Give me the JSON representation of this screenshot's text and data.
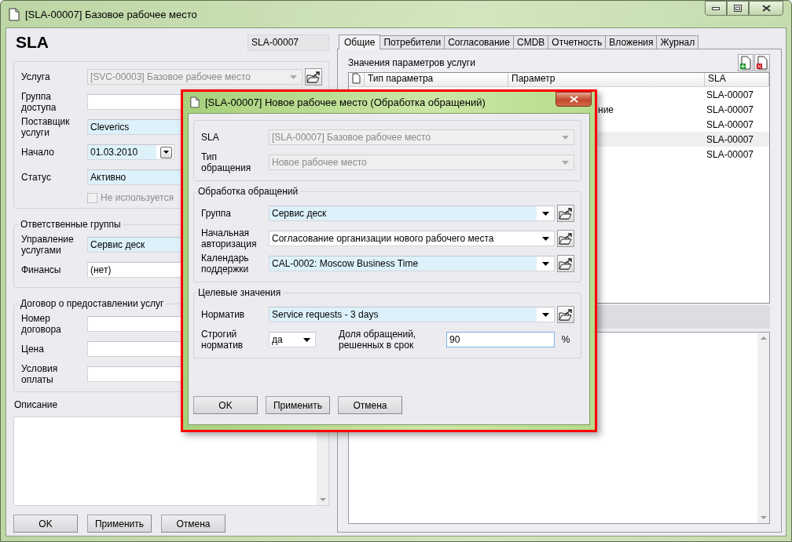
{
  "window": {
    "title": "[SLA-00007] Базовое рабочее место"
  },
  "header": {
    "title": "SLA",
    "number": "SLA-00007"
  },
  "general": {
    "fields": [
      {
        "label": "Услуга",
        "kind": "combo",
        "value": "[SVC-00003] Базовое рабочее место",
        "disabled": true,
        "link": true
      },
      {
        "label": "Группа доступа",
        "kind": "text"
      },
      {
        "label": "Поставщик услуги",
        "kind": "text",
        "value": "Cleverics",
        "required": true
      },
      {
        "label": "Начало",
        "kind": "date",
        "value": "01.03.2010",
        "required": true
      },
      {
        "label": "Статус",
        "kind": "text",
        "value": "Активно",
        "required": true
      }
    ],
    "checkbox": {
      "label": "Не используется",
      "checked": false,
      "disabled": true
    }
  },
  "responsible_groups": {
    "legend": "Ответственные группы",
    "fields": [
      {
        "label": "Управление услугами",
        "kind": "text",
        "value": "Сервис деск",
        "required": true
      },
      {
        "label": "Финансы",
        "kind": "text",
        "value": "(нет)",
        "required": false
      }
    ]
  },
  "contract": {
    "legend": "Договор о предоставлении услуг",
    "fields": [
      {
        "label": "Номер договора",
        "kind": "text"
      },
      {
        "label": "Цена",
        "kind": "text"
      },
      {
        "label": "Условия оплаты",
        "kind": "text"
      }
    ]
  },
  "description": {
    "label": "Описание"
  },
  "buttons": [
    "OK",
    "Применить",
    "Отмена"
  ],
  "tabs": [
    {
      "label": "Общие",
      "selected": true
    },
    {
      "label": "Потребители",
      "selected": false
    },
    {
      "label": "Согласование",
      "selected": false
    },
    {
      "label": "CMDB",
      "selected": false
    },
    {
      "label": "Отчетность",
      "selected": false
    },
    {
      "label": "Вложения",
      "selected": false
    },
    {
      "label": "Журнал",
      "selected": false
    }
  ],
  "parameters": {
    "title": "Значения параметров услуги",
    "columns": [
      "Тип параметра",
      "Параметр",
      "SLA"
    ],
    "rows": [
      {
        "sla": "SLA-00007",
        "selected": false
      },
      {
        "column_2": "ние",
        "sla": "SLA-00007",
        "selected": false
      },
      {
        "sla": "SLA-00007",
        "selected": false
      },
      {
        "sla": "SLA-00007",
        "selected": true
      },
      {
        "sla": "SLA-00007",
        "selected": false
      }
    ]
  },
  "dialog": {
    "title": "[SLA-00007] Новое рабочее место (Обработка обращений)",
    "fields": [
      {
        "label": "SLA",
        "kind": "combo",
        "value": "[SLA-00007] Базовое рабочее место",
        "disabled": true
      },
      {
        "label": "Тип обращения",
        "kind": "combo",
        "value": "Новое рабочее место",
        "disabled": true
      }
    ],
    "processing": {
      "legend": "Обработка обращений",
      "fields": [
        {
          "label": "Группа",
          "kind": "combo",
          "value": "Сервис деск",
          "required": true,
          "link": true
        },
        {
          "label": "Начальная авторизация",
          "kind": "combo",
          "value": "Согласование организации нового рабочего места",
          "required": false,
          "link": true
        },
        {
          "label": "Календарь поддержки",
          "kind": "combo",
          "value": "CAL-0002: Moscow Business Time",
          "required": true,
          "link": true
        }
      ]
    },
    "targets": {
      "legend": "Целевые значения",
      "fields": [
        {
          "label": "Норматив",
          "kind": "combo",
          "value": "Service requests - 3 days",
          "required": true,
          "link": true
        }
      ],
      "strict": {
        "label": "Строгий норматив",
        "value": "да"
      },
      "share": {
        "label": "Доля обращений, решенных в срок",
        "value": "90",
        "unit": "%",
        "focused": true
      }
    },
    "buttons": [
      "OK",
      "Применить",
      "Отмена"
    ]
  }
}
